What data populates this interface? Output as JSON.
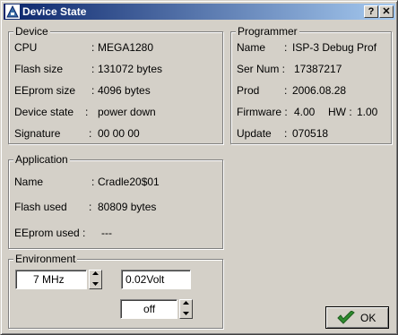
{
  "window": {
    "title": "Device State"
  },
  "titlebar": {
    "help_glyph": "?",
    "close_glyph": "✕"
  },
  "device": {
    "group_title": "Device",
    "rows": [
      {
        "label": "CPU",
        "sep": ":",
        "value": "MEGA1280"
      },
      {
        "label": "Flash size",
        "sep": ":",
        "value": "131072 bytes"
      },
      {
        "label": "EEprom size",
        "sep": ":",
        "value": "4096 bytes"
      },
      {
        "label": "Device state",
        "sep": ":",
        "value": "power down"
      },
      {
        "label": "Signature",
        "sep": ":",
        "value": "00 00 00"
      }
    ]
  },
  "programmer": {
    "group_title": "Programmer",
    "name_label": "Name",
    "name_sep": ":",
    "name_value": "ISP-3 Debug Prof",
    "sernum_label": "Ser Num :",
    "sernum_value": "17387217",
    "prod_label": "Prod",
    "prod_sep": ":",
    "prod_value": "2006.08.28",
    "firmware_label": "Firmware :",
    "firmware_value": "4.00",
    "hw_label": "HW :",
    "hw_value": "1.00",
    "update_label": "Update",
    "update_sep": ":",
    "update_value": "070518"
  },
  "application": {
    "group_title": "Application",
    "name_label": "Name",
    "name_sep": ":",
    "name_value": "Cradle20$01",
    "flash_used_label": "Flash used",
    "flash_used_sep": ":",
    "flash_used_value": "80809 bytes",
    "eeprom_used_label": "EEprom used :",
    "eeprom_used_value": "---"
  },
  "environment": {
    "group_title": "Environment",
    "frequency_value": "7 MHz",
    "voltage_value": "0.02Volt",
    "power_value": "off"
  },
  "buttons": {
    "ok_label": "OK"
  },
  "colors": {
    "title_start": "#0a246a",
    "title_end": "#a6caf0",
    "face": "#d4d0c8",
    "check_green": "#2e8b2e"
  }
}
